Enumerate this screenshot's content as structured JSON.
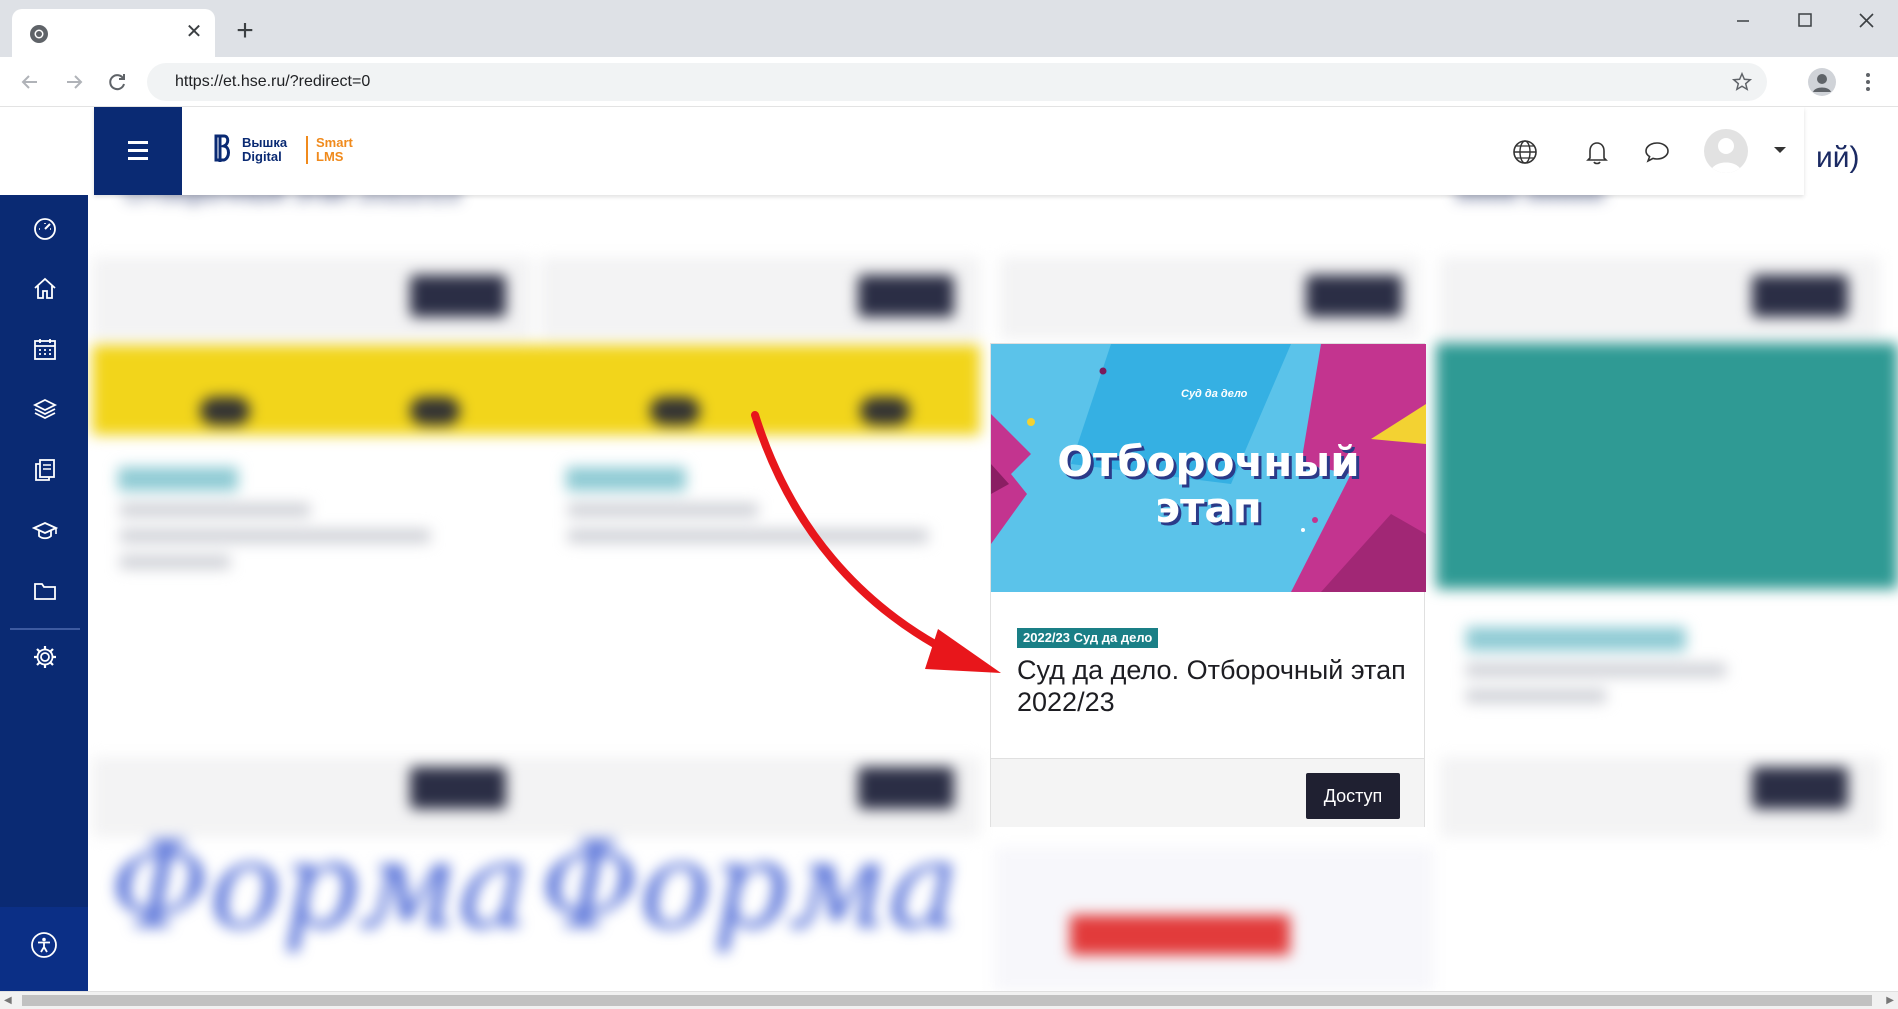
{
  "browser": {
    "tab_close": "✕",
    "new_tab": "+",
    "url": "https://et.hse.ru/?redirect=0",
    "window_controls": [
      "minimize-icon",
      "maximize-icon",
      "close-icon"
    ]
  },
  "header": {
    "logo_line1": "Вышка",
    "logo_line2": "Digital",
    "logo_smart": "Smart",
    "logo_lms": "LMS",
    "icons": [
      "globe-icon",
      "bell-icon",
      "chat-icon",
      "avatar",
      "caret-down-icon"
    ],
    "partial_right_text": "ий)"
  },
  "sidebar": {
    "icons": [
      "dashboard-icon",
      "home-icon",
      "calendar-icon",
      "layers-icon",
      "documents-icon",
      "graduation-cap-icon",
      "folder-icon",
      "settings-icon",
      "accessibility-icon"
    ]
  },
  "background": {
    "partial_title": "Отборочный этап 2022/23"
  },
  "card": {
    "image_logo": "Суд да дело",
    "image_title_line1": "Отборочный",
    "image_title_line2": "этап",
    "badge": "2022/23 Суд да дело",
    "title": "Суд да дело. Отборочный этап 2022/23",
    "button": "Доступ"
  },
  "colors": {
    "brand_navy": "#0a2a73",
    "accent_orange": "#f08a1c",
    "badge_teal": "#1a7f86",
    "button_dark": "#1f2031",
    "annotation_arrow": "#e8161b"
  }
}
